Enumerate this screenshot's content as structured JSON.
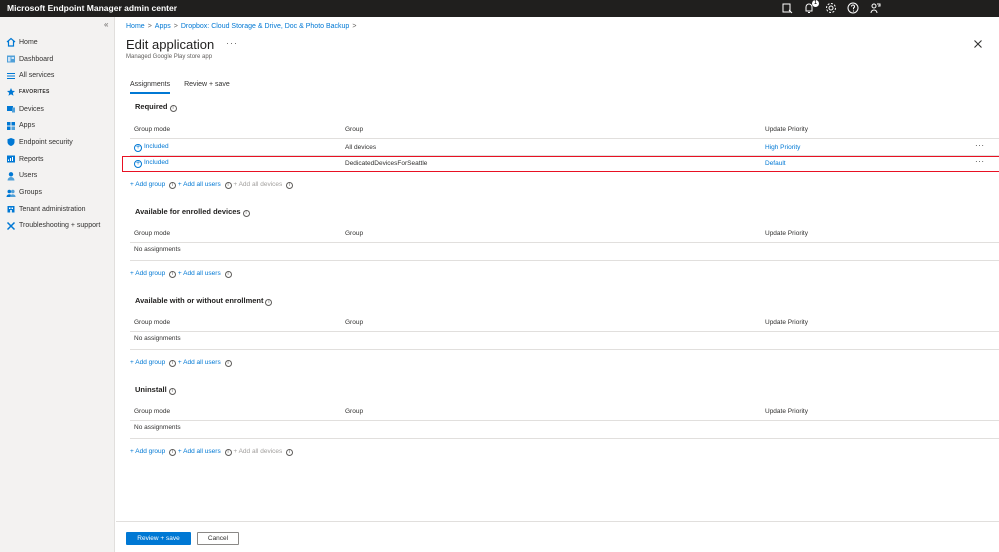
{
  "topbar": {
    "title": "Microsoft Endpoint Manager admin center",
    "notification_count": "1",
    "icons": [
      "feedback-icon",
      "bell-icon",
      "gear-icon",
      "help-icon",
      "person-feedback-icon"
    ]
  },
  "sidebar": {
    "collapse_glyph": "«",
    "items": [
      {
        "label": "Home",
        "icon": "home-icon"
      },
      {
        "label": "Dashboard",
        "icon": "dashboard-icon"
      },
      {
        "label": "All services",
        "icon": "list-icon"
      },
      {
        "label": "FAVORITES",
        "icon": "star-icon"
      },
      {
        "label": "Devices",
        "icon": "devices-icon"
      },
      {
        "label": "Apps",
        "icon": "apps-icon"
      },
      {
        "label": "Endpoint security",
        "icon": "shield-icon"
      },
      {
        "label": "Reports",
        "icon": "reports-icon"
      },
      {
        "label": "Users",
        "icon": "user-icon"
      },
      {
        "label": "Groups",
        "icon": "groups-icon"
      },
      {
        "label": "Tenant administration",
        "icon": "tenant-icon"
      },
      {
        "label": "Troubleshooting + support",
        "icon": "tools-icon"
      }
    ]
  },
  "breadcrumb": [
    "Home",
    "Apps",
    "Dropbox: Cloud Storage & Drive, Doc & Photo Backup"
  ],
  "breadcrumb_sep": ">",
  "page": {
    "title": "Edit application",
    "more": "···",
    "subtitle": "Managed Google Play store app"
  },
  "tabs": [
    "Assignments",
    "Review + save"
  ],
  "columns": {
    "group_mode": "Group mode",
    "group": "Group",
    "update_priority": "Update Priority"
  },
  "row_more": "···",
  "info_glyph": "i",
  "sections": {
    "required": {
      "title": "Required",
      "rows": [
        {
          "mode": "Included",
          "group": "All devices",
          "priority": "High Priority"
        },
        {
          "mode": "Included",
          "group": "DedicatedDevicesForSeattle",
          "priority": "Default"
        }
      ],
      "add_group": "+ Add group",
      "add_users": "+ Add all users",
      "add_devices": "+ Add all devices"
    },
    "available_enrolled": {
      "title": "Available for enrolled devices",
      "empty": "No assignments",
      "add_group": "+ Add group",
      "add_users": "+ Add all users"
    },
    "available_any": {
      "title": "Available with or without enrollment",
      "empty": "No assignments",
      "add_group": "+ Add group",
      "add_users": "+ Add all users"
    },
    "uninstall": {
      "title": "Uninstall",
      "empty": "No assignments",
      "add_group": "+ Add group",
      "add_users": "+ Add all users",
      "add_devices": "+ Add all devices"
    }
  },
  "footer": {
    "review_save": "Review + save",
    "cancel": "Cancel"
  },
  "colors": {
    "accent": "#0078d4",
    "topbar": "#201f1e",
    "highlight": "#e81123"
  }
}
